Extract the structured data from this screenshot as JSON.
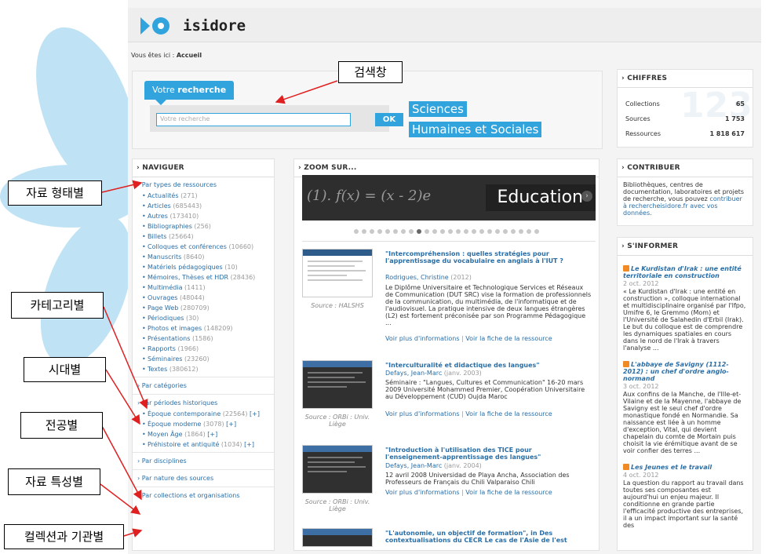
{
  "site": {
    "logo_text": "isidore",
    "breadcrumb_prefix": "Vous êtes ici :",
    "breadcrumb_current": "Accueil"
  },
  "search": {
    "tab_label_prefix": "Votre ",
    "tab_label_bold": "recherche",
    "input_placeholder": "Votre recherche",
    "ok_label": "OK",
    "tag_line1": "Sciences",
    "tag_line2": "Humaines et Sociales"
  },
  "chiffres": {
    "heading": "› CHIFFRES",
    "rows": [
      {
        "label": "Collections",
        "value": "65"
      },
      {
        "label": "Sources",
        "value": "1 753"
      },
      {
        "label": "Ressources",
        "value": "1 818 617"
      }
    ],
    "big_digits": "123"
  },
  "navigator": {
    "heading": "› NAVIGUER",
    "types_label": "› Par types de ressources",
    "types": [
      {
        "label": "Actualités",
        "count": "(271)"
      },
      {
        "label": "Articles",
        "count": "(685443)"
      },
      {
        "label": "Autres",
        "count": "(173410)"
      },
      {
        "label": "Bibliographies",
        "count": "(256)"
      },
      {
        "label": "Billets",
        "count": "(25664)"
      },
      {
        "label": "Colloques et conférences",
        "count": "(10660)"
      },
      {
        "label": "Manuscrits",
        "count": "(8640)"
      },
      {
        "label": "Matériels pédagogiques",
        "count": "(10)"
      },
      {
        "label": "Mémoires, Thèses et HDR",
        "count": "(28436)"
      },
      {
        "label": "Multimédia",
        "count": "(1411)"
      },
      {
        "label": "Ouvrages",
        "count": "(48044)"
      },
      {
        "label": "Page Web",
        "count": "(280709)"
      },
      {
        "label": "Périodiques",
        "count": "(30)"
      },
      {
        "label": "Photos et images",
        "count": "(148209)"
      },
      {
        "label": "Présentations",
        "count": "(1586)"
      },
      {
        "label": "Rapports",
        "count": "(1966)"
      },
      {
        "label": "Séminaires",
        "count": "(23260)"
      },
      {
        "label": "Textes",
        "count": "(380612)"
      }
    ],
    "categories_label": "› Par catégories",
    "periods_label": "› Par périodes historiques",
    "periods": [
      {
        "label": "Époque contemporaine",
        "count": "(22564)",
        "plus": "[+]"
      },
      {
        "label": "Époque moderne",
        "count": "(3078)",
        "plus": "[+]"
      },
      {
        "label": "Moyen Âge",
        "count": "(1864)",
        "plus": "[+]"
      },
      {
        "label": "Préhistoire et antiquité",
        "count": "(1034)",
        "plus": "[+]"
      }
    ],
    "disciplines_label": "› Par disciplines",
    "sources_label": "› Par nature des sources",
    "collections_label": "› Par collections et organisations"
  },
  "zoom": {
    "heading": "› ZOOM SUR...",
    "slider_formula": "(1). f(x) = (x - 2)e",
    "slider_label": "Education",
    "items": [
      {
        "title": "\"Intercompréhension : quelles stratégies pour l'apprentissage du vocabulaire en anglais à l'IUT ?",
        "author": "Rodrigues, Christine",
        "date": "(2012)",
        "desc": "Le Diplôme Universitaire et Technologique Services et Réseaux de Communication (DUT SRC) vise la formation de professionnels de la communication, du multimédia, de l'informatique et de l'audiovisuel. La pratique intensive de deux langues étrangères (L2) est fortement préconisée par son Programme Pédagogique ...",
        "source": "Source : HALSHS",
        "link1": "Voir plus d'informations",
        "link2": "Voir la fiche de la ressource"
      },
      {
        "title": "\"Interculturalité et didactique des langues\"",
        "author": "Defays, Jean-Marc",
        "date": "(janv. 2003)",
        "desc": "Séminaire : \"Langues, Cultures et Communication\" 16-20 mars 2009 Université Mohammed Premier, Coopération Universitaire au Développement (CUD) Oujda Maroc",
        "source": "Source : ORBi : Univ. Liège",
        "link1": "Voir plus d'informations",
        "link2": "Voir la fiche de la ressource"
      },
      {
        "title": "\"Introduction à l'utilisation des TICE pour l'enseignement-apprentissage des langues\"",
        "author": "Defays, Jean-Marc",
        "date": "(janv. 2004)",
        "desc": "12 avril 2008 Universidad de Playa Ancha, Association des Professeurs de Français du Chili Valparaiso Chili",
        "source": "Source : ORBi : Univ. Liège",
        "link1": "Voir plus d'informations",
        "link2": "Voir la fiche de la ressource"
      },
      {
        "title": "\"L'autonomie, un objectif de formation\", in Des contextualisations du CECR Le cas de l'Asie de l'est"
      }
    ]
  },
  "contribute": {
    "heading": "› CONTRIBUER",
    "text": "Bibliothèques, centres de documentation, laboratoires et projets de recherche, vous pouvez ",
    "link": "contribuer à rechercheisidore.fr avec vos données."
  },
  "inform": {
    "heading": "› S'INFORMER",
    "news": [
      {
        "title": "Le Kurdistan d'Irak : une entité territoriale en construction",
        "date": "2 oct. 2012",
        "text": "« Le Kurdistan d'Irak : une entité en construction », colloque international et multidisciplinaire organisé par l'Ifpo, Umifre 6, le Gremmo (Mom) et l'Université de Salahedin d'Erbil (Irak). Le but du colloque est de comprendre les dynamiques spatiales en cours dans le nord de l'Irak à travers l'analyse ..."
      },
      {
        "title": "L'abbaye de Savigny (1112-2012) : un chef d'ordre anglo-normand",
        "date": "3 oct. 2012",
        "text": "Aux confins de la Manche, de l'Ille-et-Vilaine et de la Mayenne, l'abbaye de Savigny est le seul chef d'ordre monastique fondé en Normandie. Sa naissance est liée à un homme d'exception, Vital, qui devient chapelain du comte de Mortain puis choisit la vie érémitique avant de se voir confier des terres ..."
      },
      {
        "title": "Les Jeunes et le travail",
        "date": "4 oct. 2012",
        "text": "La question du rapport au travail dans toutes ses composantes est aujourd'hui un enjeu majeur. Il conditionne en grande partie l'efficacité productive des entreprises, il a un impact important sur la santé des"
      }
    ]
  },
  "annotations": {
    "search_bar": "검색창",
    "resource_type": "자료 형태별",
    "category": "카테고리별",
    "period": "시대별",
    "major": "전공별",
    "nature": "자료 특성별",
    "collection": "컬렉션과 기관별"
  },
  "colors": {
    "accent": "#31a4de",
    "link": "#2a6ea6",
    "annotation_arrow": "#e02020"
  }
}
